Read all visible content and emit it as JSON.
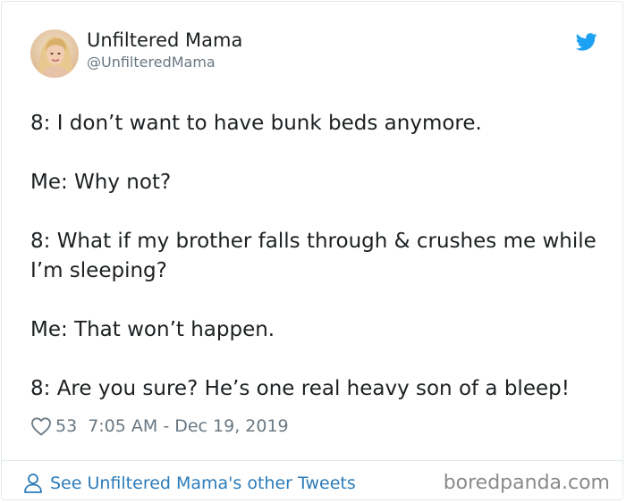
{
  "user": {
    "display_name": "Unfiltered Mama",
    "handle": "@UnfilteredMama"
  },
  "tweet": {
    "paragraphs": [
      "8: I don’t want to have bunk beds anymore.",
      "Me: Why not?",
      "8: What if my brother falls through & crushes me while I’m sleeping?",
      "Me: That won’t happen.",
      "8: Are you sure? He’s one real heavy son of a bleep!"
    ],
    "likes": "53",
    "timestamp": "7:05 AM - Dec 19, 2019"
  },
  "footer": {
    "link_label": "See Unfiltered Mama's other Tweets",
    "watermark": "boredpanda.com"
  },
  "colors": {
    "twitter_blue": "#1da1f2",
    "link_blue": "#2b7bb9",
    "muted_gray": "#697882",
    "text": "#1c2022"
  },
  "icons": {
    "brand": "twitter-bird-icon",
    "like": "heart-icon",
    "profile": "person-icon"
  }
}
